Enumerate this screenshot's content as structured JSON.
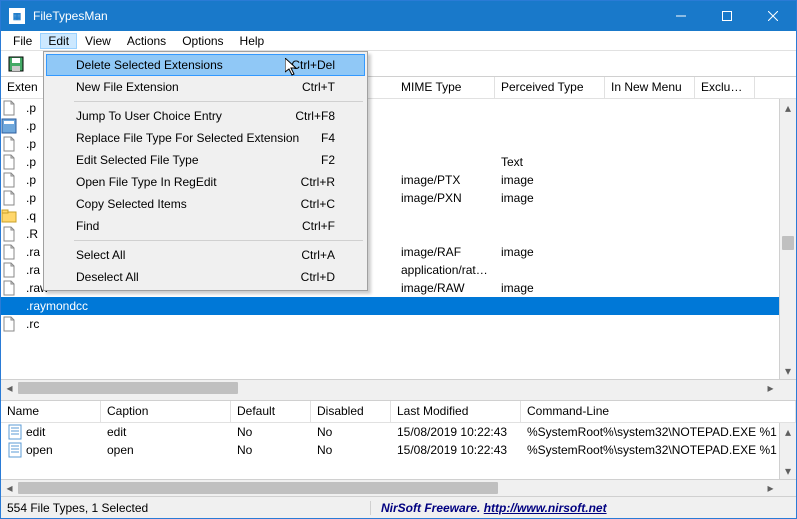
{
  "app": {
    "title": "FileTypesMan"
  },
  "menubar": [
    "File",
    "Edit",
    "View",
    "Actions",
    "Options",
    "Help"
  ],
  "edit_menu": [
    {
      "label": "Delete Selected Extensions",
      "shortcut": "Ctrl+Del",
      "highlight": true
    },
    {
      "label": "New File Extension",
      "shortcut": "Ctrl+T"
    },
    {
      "sep": true
    },
    {
      "label": "Jump To User Choice Entry",
      "shortcut": "Ctrl+F8"
    },
    {
      "label": "Replace File Type For Selected Extension",
      "shortcut": "F4"
    },
    {
      "label": "Edit Selected File Type",
      "shortcut": "F2"
    },
    {
      "label": "Open File Type In RegEdit",
      "shortcut": "Ctrl+R"
    },
    {
      "label": "Copy Selected Items",
      "shortcut": "Ctrl+C"
    },
    {
      "label": "Find",
      "shortcut": "Ctrl+F"
    },
    {
      "sep": true
    },
    {
      "label": "Select All",
      "shortcut": "Ctrl+A"
    },
    {
      "label": "Deselect All",
      "shortcut": "Ctrl+D"
    }
  ],
  "top_grid": {
    "columns_left": "Exten",
    "columns_right": [
      "MIME Type",
      "Perceived Type",
      "In New Menu",
      "Excluded"
    ],
    "rows": [
      {
        "ext": ".p",
        "mime": "",
        "pt": "",
        "ico": "page"
      },
      {
        "ext": ".p",
        "mime": "",
        "pt": "",
        "ico": "app"
      },
      {
        "ext": ".p",
        "mime": "",
        "pt": "",
        "ico": "page"
      },
      {
        "ext": ".p",
        "mime": "",
        "pt": "Text",
        "ico": "page"
      },
      {
        "ext": ".p",
        "mime": "image/PTX",
        "pt": "image",
        "ico": "page"
      },
      {
        "ext": ".p",
        "mime": "image/PXN",
        "pt": "image",
        "ico": "page"
      },
      {
        "ext": ".q",
        "mime": "",
        "pt": "",
        "ico": "folder"
      },
      {
        "ext": ".R",
        "mime": "",
        "pt": "",
        "ico": "page"
      },
      {
        "ext": ".ra",
        "mime": "image/RAF",
        "pt": "image",
        "ico": "page"
      },
      {
        "ext": ".ra",
        "mime": "application/rat…",
        "pt": "",
        "ico": "page"
      },
      {
        "ext": ".raw",
        "mime": "image/RAW",
        "pt": "image",
        "ico": "page"
      },
      {
        "ext": ".raymondcc",
        "mime": "",
        "pt": "",
        "selected": true,
        "ico": "none"
      },
      {
        "ext": ".rc",
        "mime": "",
        "pt": "",
        "ico": "page"
      }
    ]
  },
  "bottom_grid": {
    "columns": [
      "Name",
      "Caption",
      "Default",
      "Disabled",
      "Last Modified",
      "Command-Line"
    ],
    "rows": [
      {
        "name": "edit",
        "caption": "edit",
        "def": "No",
        "dis": "No",
        "lm": "15/08/2019 10:22:43",
        "cl": "%SystemRoot%\\system32\\NOTEPAD.EXE %1"
      },
      {
        "name": "open",
        "caption": "open",
        "def": "No",
        "dis": "No",
        "lm": "15/08/2019 10:22:43",
        "cl": "%SystemRoot%\\system32\\NOTEPAD.EXE %1"
      }
    ]
  },
  "statusbar": {
    "left": "554 File Types, 1 Selected",
    "right_text": "NirSoft Freeware. ",
    "right_link": "http://www.nirsoft.net"
  }
}
